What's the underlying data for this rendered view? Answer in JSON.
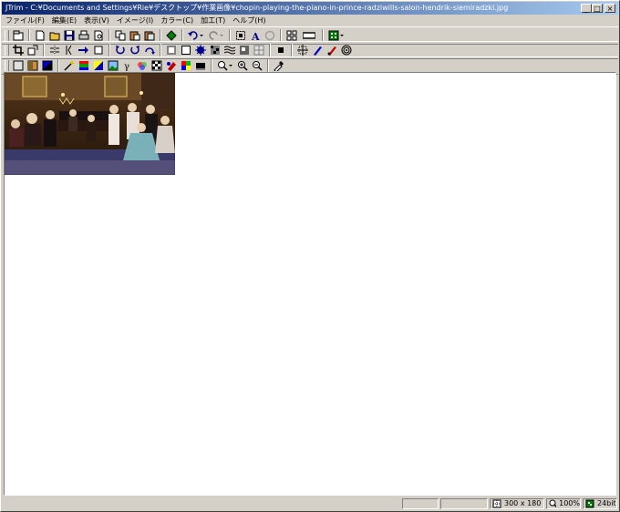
{
  "window": {
    "title": "JTrim - C:¥Documents and Settings¥Rie¥デスクトップ¥作業画像¥chopin-playing-the-piano-in-prince-radziwills-salon-hendrik-siemiradzki.jpg",
    "minimize": "_",
    "maximize": "□",
    "close": "×"
  },
  "menu": [
    {
      "label": "ファイル(F)"
    },
    {
      "label": "編集(E)"
    },
    {
      "label": "表示(V)"
    },
    {
      "label": "イメージ(I)"
    },
    {
      "label": "カラー(C)"
    },
    {
      "label": "加工(T)"
    },
    {
      "label": "ヘルプ(H)"
    }
  ],
  "toolbar1": [
    {
      "icon": "open-recent-icon",
      "interactable": true
    },
    {
      "icon": "new-file-icon",
      "interactable": true
    },
    {
      "icon": "open-folder-icon",
      "interactable": true
    },
    {
      "icon": "save-icon",
      "interactable": true
    },
    {
      "icon": "print-icon",
      "interactable": true
    },
    {
      "icon": "print-preview-icon",
      "interactable": true
    },
    {
      "icon": "copy-icon",
      "interactable": true
    },
    {
      "icon": "paste-icon",
      "interactable": true
    },
    {
      "icon": "paste-new-icon",
      "interactable": true
    },
    {
      "icon": "capture-icon",
      "interactable": true
    },
    {
      "icon": "undo-icon",
      "interactable": true
    },
    {
      "icon": "redo-icon",
      "interactable": false
    },
    {
      "icon": "select-all-icon",
      "interactable": true
    },
    {
      "icon": "text-icon",
      "interactable": true
    },
    {
      "icon": "disabled-icon",
      "interactable": false
    },
    {
      "icon": "grid-view-icon",
      "interactable": true
    },
    {
      "icon": "film-strip-icon",
      "interactable": true
    },
    {
      "icon": "color-palette-icon",
      "interactable": true
    }
  ],
  "toolbar2": [
    "crop-icon",
    "resize-icon",
    "flip-horizontal-icon",
    "flip-vertical-icon",
    "rotate-arbitrary-icon",
    "rotate-icon",
    "rotate-left-icon",
    "rotate-right-icon",
    "rotate-180-icon",
    "frame-icon",
    "border-icon",
    "sunburst-icon",
    "mosaic-icon",
    "wave-icon",
    "emboss-icon",
    "tile-icon",
    "black-square-icon",
    "expand-icon",
    "brush-icon",
    "eraser-pen-icon",
    "spiral-icon"
  ],
  "toolbar3": [
    "grayscale-icon",
    "sepia-icon",
    "invert-icon",
    "magic-wand-icon",
    "gradient-icon",
    "rgb-icon",
    "picture-icon",
    "gamma-icon",
    "color-balance-icon",
    "checker-icon",
    "color-replace-icon",
    "palette-icon",
    "monochrome-icon",
    "zoom-menu-icon",
    "zoom-in-icon",
    "zoom-out-icon",
    "eyedropper-icon"
  ],
  "status": {
    "size": "300 x 180",
    "zoom": "100%",
    "depth": "24bit"
  },
  "colors": {
    "titlebar_start": "#0a246a",
    "titlebar_end": "#a6caf0",
    "face": "#d4d0c8"
  }
}
